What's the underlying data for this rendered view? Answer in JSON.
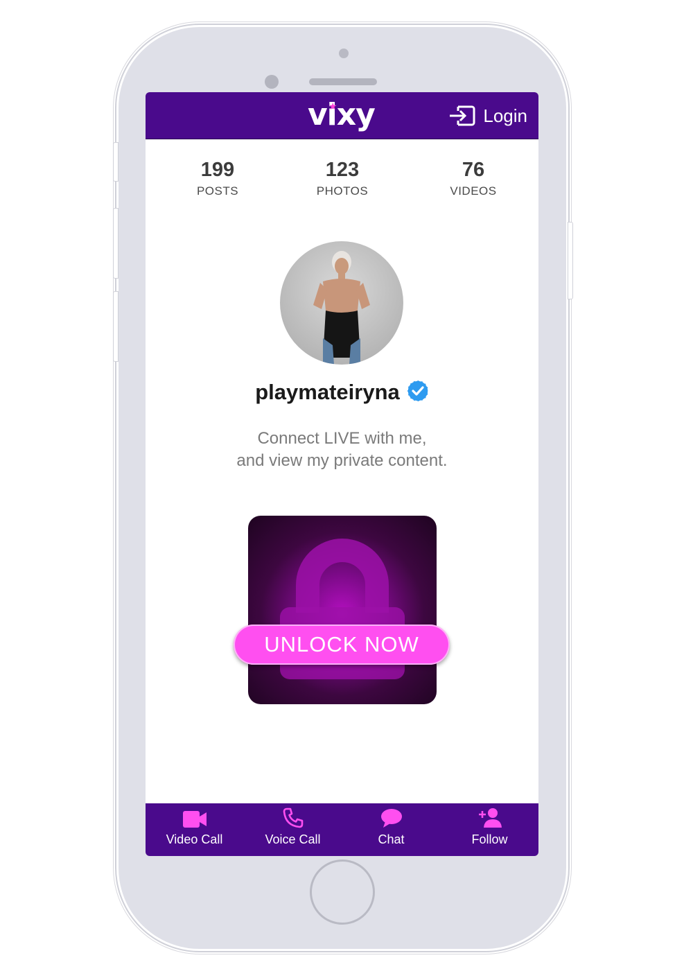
{
  "header": {
    "logo_text": "vixy",
    "login_label": "Login"
  },
  "stats": [
    {
      "value": "199",
      "label": "POSTS"
    },
    {
      "value": "123",
      "label": "PHOTOS"
    },
    {
      "value": "76",
      "label": "VIDEOS"
    }
  ],
  "profile": {
    "username": "playmateiryna",
    "tagline_line1": "Connect LIVE with me,",
    "tagline_line2": "and view my private content."
  },
  "unlock": {
    "label": "UNLOCK NOW"
  },
  "nav": [
    {
      "label": "Video Call",
      "icon": "video-camera-icon"
    },
    {
      "label": "Voice Call",
      "icon": "phone-icon"
    },
    {
      "label": "Chat",
      "icon": "chat-bubble-icon"
    },
    {
      "label": "Follow",
      "icon": "add-user-icon"
    }
  ],
  "colors": {
    "brand_purple": "#4a0a8c",
    "accent_pink": "#ff4ff0",
    "verified_blue": "#2e9bf0"
  }
}
